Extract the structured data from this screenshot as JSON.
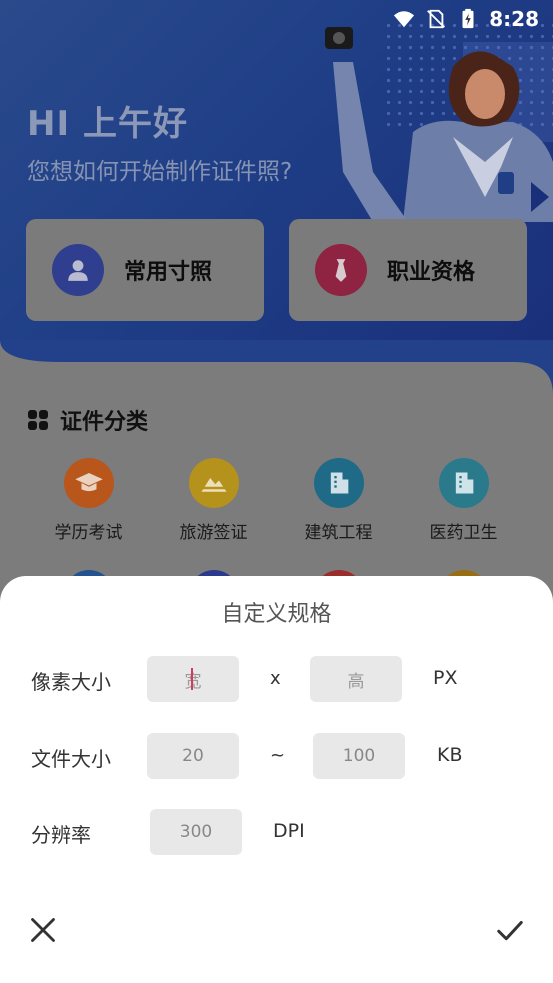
{
  "status_bar": {
    "time": "8:28"
  },
  "hero": {
    "greeting": "HI 上午好",
    "subtitle": "您想如何开始制作证件照?"
  },
  "quick_actions": [
    {
      "label": "常用寸照",
      "icon": "person-icon",
      "color": "#2f3e8f"
    },
    {
      "label": "职业资格",
      "icon": "tie-icon",
      "color": "#8e2342"
    }
  ],
  "category_section": {
    "title": "证件分类",
    "items": [
      {
        "label": "学历考试",
        "icon": "graduation-cap-icon",
        "color": "#b8561c"
      },
      {
        "label": "旅游签证",
        "icon": "mountain-icon",
        "color": "#b4921b"
      },
      {
        "label": "建筑工程",
        "icon": "building-icon",
        "color": "#1f6a86"
      },
      {
        "label": "医药卫生",
        "icon": "hospital-icon",
        "color": "#2b7a8c"
      }
    ],
    "second_row_colors": [
      "#22538e",
      "#2b3a8c",
      "#9a2c2c",
      "#9a6d12"
    ]
  },
  "custom_spec_sheet": {
    "title": "自定义规格",
    "pixel_size": {
      "label": "像素大小",
      "width_placeholder": "宽",
      "separator": "x",
      "height_placeholder": "高",
      "unit": "PX"
    },
    "file_size": {
      "label": "文件大小",
      "min_value": "20",
      "separator": "~",
      "max_value": "100",
      "unit": "KB"
    },
    "resolution": {
      "label": "分辨率",
      "value": "300",
      "unit": "DPI"
    }
  }
}
